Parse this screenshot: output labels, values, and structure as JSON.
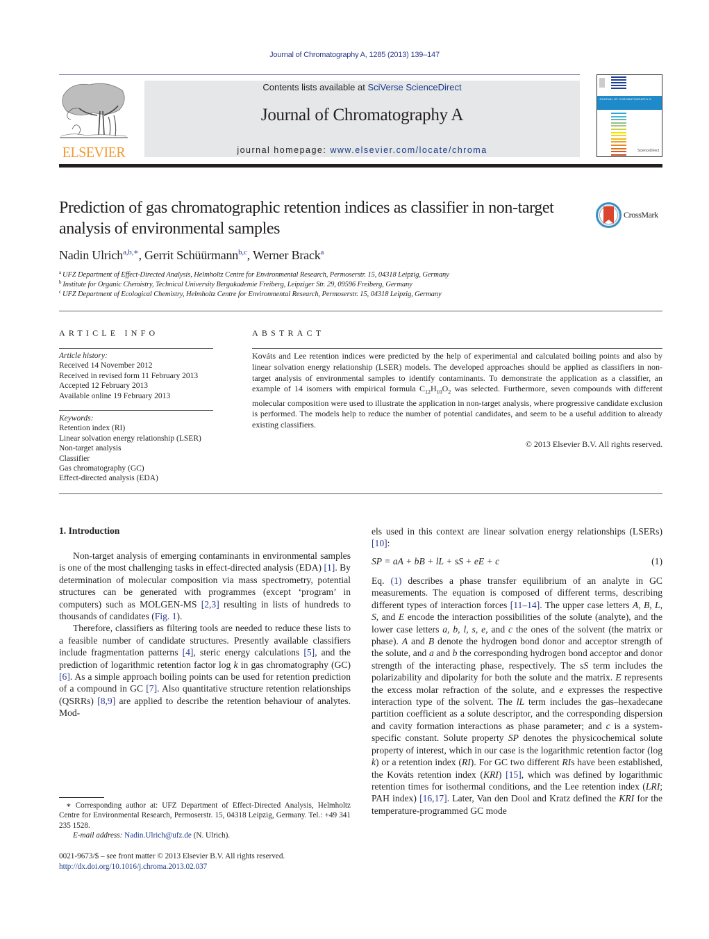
{
  "citation": "Journal of Chromatography A, 1285 (2013) 139–147",
  "banner": {
    "contents_prefix": "Contents lists available at ",
    "contents_link": "SciVerse ScienceDirect",
    "journal_title": "Journal of Chromatography A",
    "homepage_prefix": "journal homepage: ",
    "homepage_link": "www.elsevier.com/locate/chroma"
  },
  "publisher": {
    "wordmark": "ELSEVIER",
    "brand_color": "#f29a33"
  },
  "cover": {
    "band_text": "JOURNAL OF CHROMATOGRAPHY A",
    "band_color": "#1f8ac9",
    "stripe_colors": [
      "#1c3f94",
      "#1c3f94",
      "#1c3f94",
      "#1c3f94",
      "#1c3f94",
      "#2aa7d8",
      "#4ab4d6",
      "#5fb3b8",
      "#8cc08f",
      "#a9c870",
      "#c7d24a",
      "#f2e400",
      "#f4d21a",
      "#f2b61c",
      "#eea021",
      "#e9851f",
      "#e26d1e",
      "#d9551d",
      "#c9431b"
    ],
    "publisher_text": "ScienceDirect"
  },
  "article": {
    "title": "Prediction of gas chromatographic retention indices as classifier in non-target analysis of environmental samples",
    "crossmark_label": "CrossMark",
    "authors": [
      {
        "name": "Nadin Ulrich",
        "sup": "a,b,∗",
        "sep": ", "
      },
      {
        "name": "Gerrit Schüürmann",
        "sup": "b,c",
        "sep": ", "
      },
      {
        "name": "Werner Brack",
        "sup": "a",
        "sep": ""
      }
    ],
    "affiliations": [
      {
        "mark": "a",
        "text": "UFZ Department of Effect-Directed Analysis, Helmholtz Centre for Environmental Research, Permoserstr. 15, 04318 Leipzig, Germany"
      },
      {
        "mark": "b",
        "text": "Institute for Organic Chemistry, Technical University Bergakademie Freiberg, Leipziger Str. 29, 09596 Freiberg, Germany"
      },
      {
        "mark": "c",
        "text": "UFZ Department of Ecological Chemistry, Helmholtz Centre for Environmental Research, Permoserstr. 15, 04318 Leipzig, Germany"
      }
    ]
  },
  "article_info": {
    "heading": "ARTICLE INFO",
    "history_label": "Article history:",
    "history": [
      "Received 14 November 2012",
      "Received in revised form 11 February 2013",
      "Accepted 12 February 2013",
      "Available online 19 February 2013"
    ],
    "keywords_label": "Keywords:",
    "keywords": [
      "Retention index (RI)",
      "Linear solvation energy relationship (LSER)",
      "Non-target analysis",
      "Classifier",
      "Gas chromatography (GC)",
      "Effect-directed analysis (EDA)"
    ]
  },
  "abstract": {
    "heading": "ABSTRACT",
    "text_1": "Kováts and Lee retention indices were predicted by the help of experimental and calculated boiling points and also by linear solvation energy relationship (LSER) models. The developed approaches should be applied as classifiers in non-target analysis of environmental samples to identify contaminants. To demonstrate the application as a classifier, an example of 14 isomers with empirical formula C",
    "formula_c": "12",
    "formula_h_label": "H",
    "formula_h": "10",
    "formula_o_label": "O",
    "formula_o": "2",
    "text_2": " was selected. Furthermore, seven compounds with different molecular composition were used to illustrate the application in non-target analysis, where progressive candidate exclusion is performed. The models help to reduce the number of potential candidates, and seem to be a useful addition to already existing classifiers.",
    "copyright": "© 2013 Elsevier B.V. All rights reserved."
  },
  "introduction": {
    "heading": "1.  Introduction",
    "p1": {
      "t1": "Non-target analysis of emerging contaminants in environmental samples is one of the most challenging tasks in effect-directed analysis (EDA) ",
      "r1": "[1]",
      "t2": ". By determination of molecular composition via mass spectrometry, potential structures can be generated with programmes (except ‘program’ in computers) such as MOLGEN-MS ",
      "r2": "[2,3]",
      "t3": " resulting in lists of hundreds to thousands of candidates (",
      "r3": "Fig. 1",
      "t4": ")."
    },
    "p2": {
      "t1": "Therefore, classifiers as filtering tools are needed to reduce these lists to a feasible number of candidate structures. Presently available classifiers include fragmentation patterns ",
      "r1": "[4]",
      "t2": ", steric energy calculations ",
      "r2": "[5]",
      "t3": ", and the prediction of logarithmic retention factor log ",
      "k": "k",
      "t4": " in gas chromatography (GC) ",
      "r3": "[6]",
      "t5": ". As a simple approach boiling points can be used for retention prediction of a compound in GC ",
      "r4": "[7]",
      "t6": ". Also quantitative structure retention relationships (QSRRs) ",
      "r5": "[8,9]",
      "t7": " are applied to describe the retention behaviour of analytes. Mod-"
    },
    "p3": {
      "t1": "els used in this context are linear solvation energy relationships (LSERs) ",
      "r1": "[10]",
      "t2": ":"
    },
    "equation": "SP = aA + bB + lL + sS + eE + c",
    "equation_number": "(1)",
    "p4": {
      "t1": "Eq. ",
      "r1": "(1)",
      "t2": " describes a phase transfer equilibrium of an analyte in GC measurements. The equation is composed of different terms, describing different types of interaction forces ",
      "r2": "[11–14]",
      "t3": ". The upper case letters ",
      "i1": "A, B, L, S,",
      "t4": " and ",
      "i2": "E",
      "t5": " encode the interaction possibilities of the solute (analyte), and the lower case letters ",
      "i3": "a, b, l, s, e,",
      "t6": " and ",
      "i4": "c",
      "t7": " the ones of the solvent (the matrix or phase). ",
      "i5": "A",
      "t8": " and ",
      "i6": "B",
      "t9": " denote the hydrogen bond donor and acceptor strength of the solute, and ",
      "i7": "a",
      "t10": " and ",
      "i8": "b",
      "t11": " the corresponding hydrogen bond acceptor and donor strength of the interacting phase, respectively. The ",
      "i9": "sS",
      "t12": " term includes the polarizability and dipolarity for both the solute and the matrix. ",
      "i10": "E",
      "t13": " represents the excess molar refraction of the solute, and ",
      "i11": "e",
      "t14": " expresses the respective interaction type of the solvent. The ",
      "i12": "lL",
      "t15": " term includes the gas–hexadecane partition coefficient as a solute descriptor, and the corresponding dispersion and cavity formation interactions as phase parameter; and ",
      "i13": "c",
      "t16": " is a system-specific constant. Solute property ",
      "i14": "SP",
      "t17": " denotes the physicochemical solute property of interest, which in our case is the logarithmic retention factor (log ",
      "i15": "k",
      "t18": ") or a retention index (",
      "i16": "RI",
      "t19": "). For GC two different ",
      "i17": "RI",
      "t20": "s have been established, the Kováts retention index (",
      "i18": "KRI",
      "t21": ") ",
      "r3": "[15]",
      "t22": ", which was defined by logarithmic retention times for isothermal conditions, and the Lee retention index (",
      "i19": "LRI",
      "t23": "; PAH index) ",
      "r4": "[16,17]",
      "t24": ". Later, Van den Dool and Kratz defined the ",
      "i20": "KRI",
      "t25": " for the temperature-programmed GC mode"
    }
  },
  "footnote": {
    "text": "∗ Corresponding author at: UFZ Department of Effect-Directed Analysis, Helmholtz Centre for Environmental Research, Permoserstr. 15, 04318 Leipzig, Germany. Tel.: +49 341 235 1528.",
    "email_label": "E-mail address:",
    "email": "Nadin.Ulrich@ufz.de",
    "email_suffix": " (N. Ulrich)."
  },
  "front_matter": {
    "issn_line": "0021-9673/$ – see front matter © 2013 Elsevier B.V. All rights reserved.",
    "doi": "http://dx.doi.org/10.1016/j.chroma.2013.02.037"
  }
}
